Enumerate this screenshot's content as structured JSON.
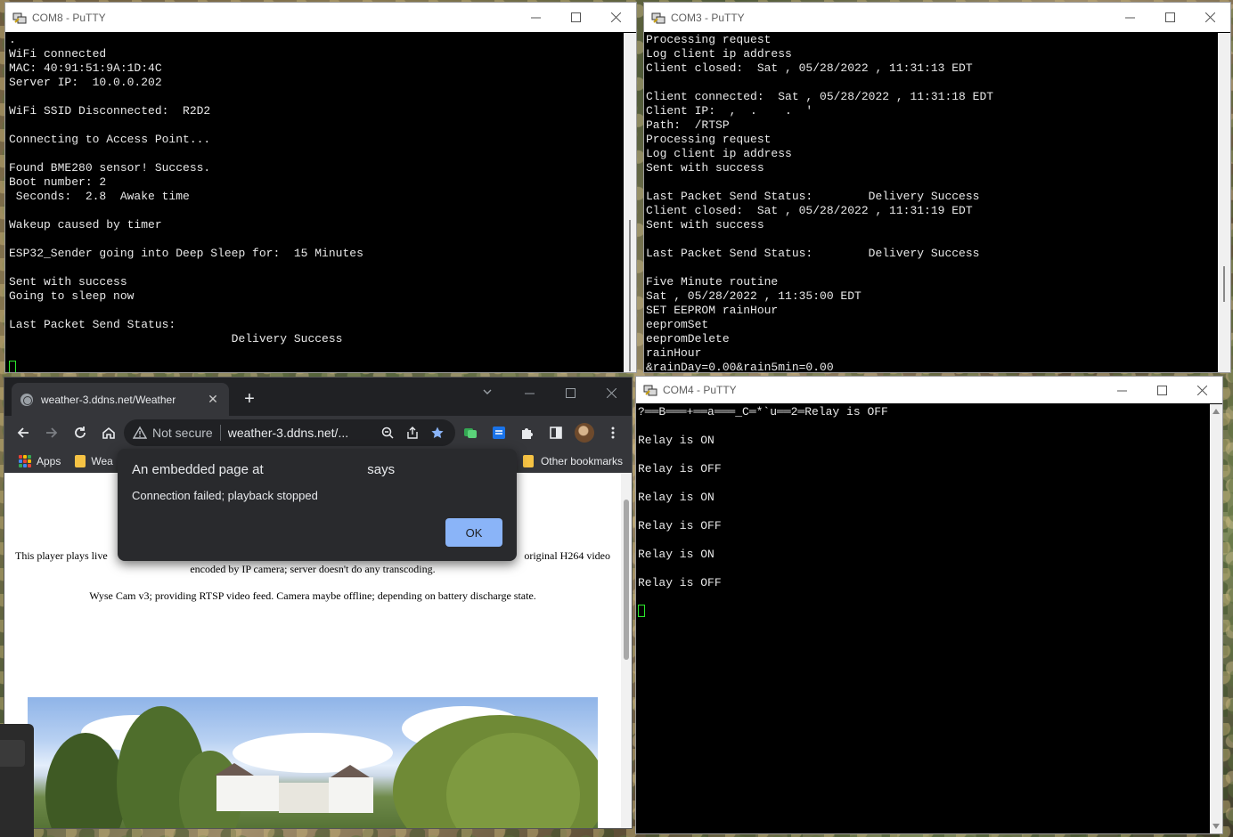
{
  "com8": {
    "title": "COM8 - PuTTY",
    "lines": [
      ".",
      "WiFi connected",
      "MAC: 40:91:51:9A:1D:4C",
      "Server IP:  10.0.0.202",
      "",
      "WiFi SSID Disconnected:  R2D2",
      "",
      "Connecting to Access Point...",
      "",
      "Found BME280 sensor! Success.",
      "Boot number: 2",
      " Seconds:  2.8  Awake time",
      "",
      "Wakeup caused by timer",
      "",
      "ESP32_Sender going into Deep Sleep for:  15 Minutes",
      "",
      "Sent with success",
      "Going to sleep now",
      "",
      "Last Packet Send Status:",
      "                                Delivery Success",
      ""
    ]
  },
  "com3": {
    "title": "COM3 - PuTTY",
    "lines": [
      "Processing request",
      "Log client ip address",
      "Client closed:  Sat , 05/28/2022 , 11:31:13 EDT",
      "",
      "Client connected:  Sat , 05/28/2022 , 11:31:18 EDT",
      "Client IP:  ,  .    .  '",
      "Path:  /RTSP",
      "Processing request",
      "Log client ip address",
      "Sent with success",
      "",
      "Last Packet Send Status:        Delivery Success",
      "Client closed:  Sat , 05/28/2022 , 11:31:19 EDT",
      "Sent with success",
      "",
      "Last Packet Send Status:        Delivery Success",
      "",
      "Five Minute routine",
      "Sat , 05/28/2022 , 11:35:00 EDT",
      "SET EEPROM rainHour",
      "eepromSet",
      "eepromDelete",
      "rainHour",
      "&rainDay=0.00&rain5min=0.00"
    ]
  },
  "com4": {
    "title": "COM4 - PuTTY",
    "lines": [
      "?══B═══+══a═══_C═*`u══2═Relay is OFF",
      "",
      "Relay is ON",
      "",
      "Relay is OFF",
      "",
      "Relay is ON",
      "",
      "Relay is OFF",
      "",
      "Relay is ON",
      "",
      "Relay is OFF",
      ""
    ]
  },
  "browser": {
    "tab_title": "weather-3.ddns.net/Weather",
    "new_tab": "+",
    "not_secure": "Not secure",
    "url": "weather-3.ddns.net/...",
    "bookmarks": {
      "apps": "Apps",
      "folder1": "Wea",
      "other": "Other bookmarks"
    },
    "content": {
      "para1_left": "This player plays live",
      "para1_right": "original H264 video",
      "para1_line2": "encoded by IP camera; server doesn't do any transcoding.",
      "para2": "Wyse Cam v3; providing RTSP video feed. Camera maybe offline; depending on battery discharge state."
    }
  },
  "dialog": {
    "title": "An embedded page at                            says",
    "message": "Connection failed; playback stopped",
    "ok": "OK"
  },
  "colors": {
    "terminal_bg": "#000000",
    "terminal_fg": "#e8e8e8",
    "cursor": "#2ce82c",
    "chrome_dark": "#35363a",
    "dialog_bg": "#292a2d",
    "ok_button": "#8ab4f8"
  }
}
